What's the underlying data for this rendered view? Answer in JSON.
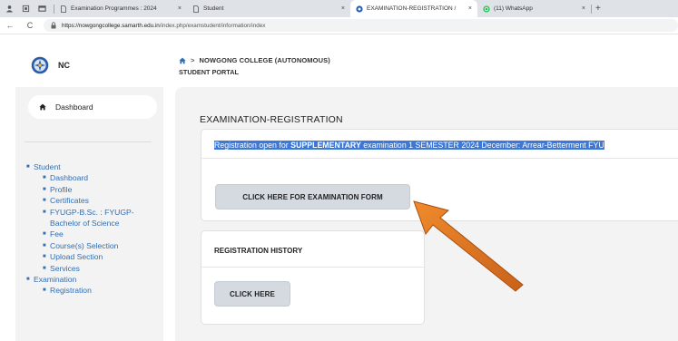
{
  "browser": {
    "tabs": [
      {
        "title": "Examination Programmes : 2024",
        "close": "×",
        "active": false
      },
      {
        "title": "Student",
        "close": "×",
        "active": false
      },
      {
        "title": "EXAMINATION-REGISTRATION / ",
        "close": "×",
        "active": true
      },
      {
        "title": "(11) WhatsApp",
        "close": "×",
        "active": false
      }
    ],
    "new_tab": "+",
    "url_host": "https://nowgongcollege.samarth.edu.in",
    "url_path": "/index.php/examstudent/information/index",
    "nav_back": "←",
    "nav_reload": "C"
  },
  "brand": {
    "short_name": "NC"
  },
  "header": {
    "breadcrumb_sep": ">",
    "college": "NOWGONG COLLEGE (AUTONOMOUS)",
    "portal": "STUDENT PORTAL"
  },
  "sidebar": {
    "dashboard_label": "Dashboard",
    "bullet": "■",
    "student": {
      "label": "Student",
      "items": {
        "dashboard": "Dashboard",
        "profile": "Profile",
        "certificates": "Certificates",
        "program": "FYUGP-B.Sc. : FYUGP-Bachelor of Science",
        "fee": "Fee",
        "course_selection": "Course(s) Selection",
        "upload": "Upload Section",
        "services": "Services"
      }
    },
    "examination": {
      "label": "Examination",
      "items": {
        "registration": "Registration"
      }
    }
  },
  "main": {
    "title": "EXAMINATION-REGISTRATION",
    "notice_prefix": "Registration open for ",
    "notice_strong": "SUPPLEMENTARY",
    "notice_suffix": " examination 1 SEMESTER 2024 December: Arrear-Betterment FYU",
    "exam_form_button": "CLICK HERE FOR EXAMINATION FORM",
    "history_title": "REGISTRATION HISTORY",
    "history_button": "CLICK HERE"
  },
  "colors": {
    "accent": "#3b78d8",
    "link": "#2f6fb4",
    "arrow": "#e07b24",
    "panel": "#f3f3f3"
  }
}
